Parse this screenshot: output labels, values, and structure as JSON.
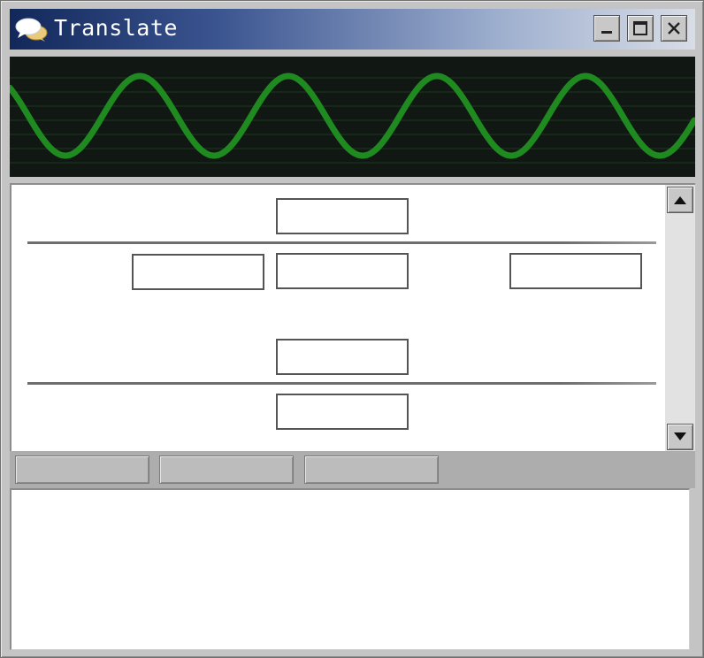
{
  "window": {
    "title": "Translate",
    "icon": "speech-bubbles-icon",
    "controls": [
      "minimize-icon",
      "maximize-icon",
      "close-icon"
    ]
  },
  "waveform": {
    "colors": {
      "background": "#111814",
      "wave": "#1f8a1f",
      "grid": "#1b3a1b"
    }
  },
  "form": {
    "fields": [
      {
        "name": "numerator-field",
        "value": ""
      },
      {
        "name": "left-field",
        "value": ""
      },
      {
        "name": "center-field",
        "value": ""
      },
      {
        "name": "right-field",
        "value": ""
      },
      {
        "name": "lower-numerator-field",
        "value": ""
      },
      {
        "name": "denominator-field",
        "value": ""
      }
    ]
  },
  "toolbar": {
    "buttons": [
      "",
      "",
      ""
    ]
  },
  "output": {
    "text": ""
  }
}
